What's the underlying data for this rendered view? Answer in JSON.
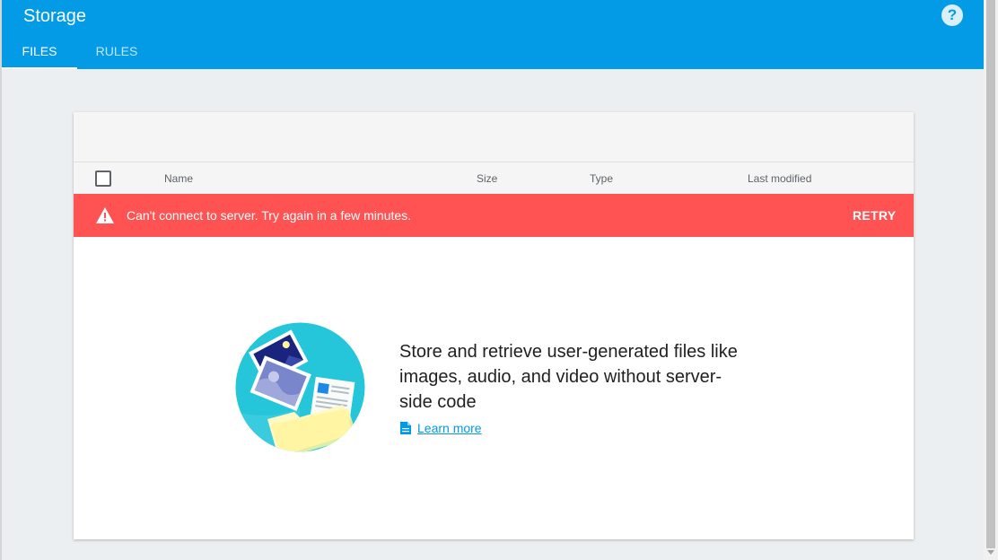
{
  "header": {
    "title": "Storage",
    "help_icon": "help-circle-icon"
  },
  "tabs": [
    {
      "label": "FILES",
      "active": true
    },
    {
      "label": "RULES",
      "active": false
    }
  ],
  "table": {
    "columns": [
      "Name",
      "Size",
      "Type",
      "Last modified"
    ]
  },
  "error": {
    "message": "Can't connect to server. Try again in a few minutes.",
    "action": "RETRY",
    "color": "#ff5252"
  },
  "empty_state": {
    "text": "Store and retrieve user-generated files like images, audio, and video without server-side code",
    "link": "Learn more"
  },
  "colors": {
    "brand": "#039be5",
    "background": "#eceff1"
  }
}
